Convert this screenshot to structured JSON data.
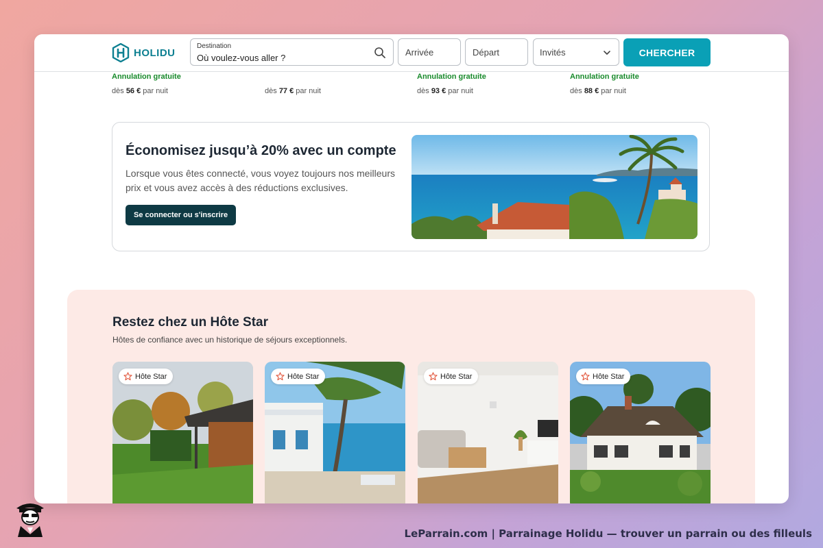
{
  "brand": {
    "name": "HOLIDU",
    "color": "#0c7f91"
  },
  "search": {
    "destination_label": "Destination",
    "destination_placeholder": "Où voulez-vous aller ?",
    "arrival": "Arrivée",
    "departure": "Départ",
    "guests": "Invités",
    "button": "CHERCHER",
    "button_color": "#0aa0b6"
  },
  "listings_prices": [
    {
      "free_cancel": "Annulation gratuite",
      "prefix": "dès",
      "amount": "56 €",
      "suffix": "par nuit"
    },
    {
      "free_cancel": "",
      "prefix": "dès",
      "amount": "77 €",
      "suffix": "par nuit"
    },
    {
      "free_cancel": "Annulation gratuite",
      "prefix": "dès",
      "amount": "93 €",
      "suffix": "par nuit"
    },
    {
      "free_cancel": "Annulation gratuite",
      "prefix": "dès",
      "amount": "88 €",
      "suffix": "par nuit"
    }
  ],
  "promo": {
    "title": "Économisez jusqu’à 20% avec un compte",
    "text": "Lorsque vous êtes connecté, vous voyez toujours nos meilleurs prix et vous avez accès à des réductions exclusives.",
    "button": "Se connecter ou s'inscrire"
  },
  "star_hosts": {
    "title": "Restez chez un Hôte Star",
    "subtitle": "Hôtes de confiance avec un historique de séjours exceptionnels.",
    "badge": "Hôte Star",
    "cards": [
      {
        "badge": "Hôte Star",
        "photo": "wooden-cabin-photo"
      },
      {
        "badge": "Hôte Star",
        "photo": "seaside-villa-photo"
      },
      {
        "badge": "Hôte Star",
        "photo": "living-room-photo"
      },
      {
        "badge": "Hôte Star",
        "photo": "thatched-cottage-photo"
      }
    ]
  },
  "footer": {
    "credit": "LeParrain.com | Parrainage Holidu — trouver un parrain ou des filleuls"
  },
  "icons": [
    "holidu-logo-icon",
    "search-icon",
    "chevron-down-icon",
    "star-icon",
    "mascot-icon"
  ]
}
